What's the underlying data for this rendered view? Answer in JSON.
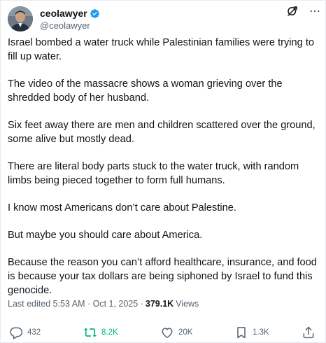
{
  "author": {
    "display_name": "ceolawyer",
    "handle": "@ceolawyer",
    "verified": true,
    "verified_color": "#1d9bf0"
  },
  "header_icons": [
    "grok-icon",
    "more-icon"
  ],
  "post": {
    "paragraphs": [
      "Israel bombed a water truck while Palestinian families were trying to fill up water.",
      "The video of the massacre shows a woman grieving over the shredded body of her husband.",
      "Six feet away there are men and children scattered over the ground, some alive but mostly dead.",
      "There are literal body parts stuck to the water truck, with random limbs being pieced together to form full humans.",
      "I know most Americans don’t care about Palestine.",
      "But maybe you should care about America.",
      "Because the reason you can’t afford healthcare, insurance, and food is because your tax dollars are being siphoned by Israel to fund this genocide."
    ]
  },
  "meta": {
    "edited_label": "Last edited 5:53 AM · Oct 1, 2025 ·",
    "views_count": "379.1K",
    "views_label": "Views"
  },
  "actions": {
    "replies": "432",
    "reposts": "8.2K",
    "likes": "20K",
    "bookmarks": "1.3K",
    "repost_color": "#00ba7c",
    "icon_color": "#536471"
  }
}
